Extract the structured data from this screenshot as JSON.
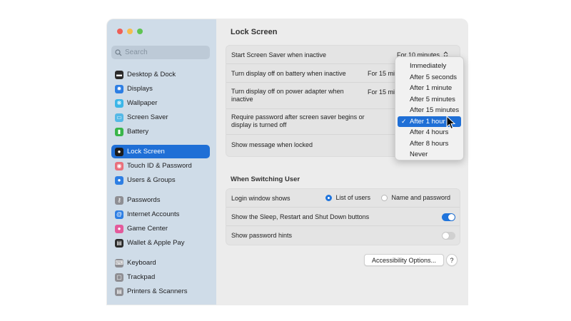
{
  "window": {
    "traffic_colors": [
      "#ee5f57",
      "#f5bd4f",
      "#5fc453"
    ]
  },
  "search": {
    "placeholder": "Search"
  },
  "sidebar": {
    "items": [
      {
        "label": "Desktop & Dock",
        "icon": "dock-icon",
        "color": "#2b2b2b"
      },
      {
        "label": "Displays",
        "icon": "display-icon",
        "color": "#2d7ee3"
      },
      {
        "label": "Wallpaper",
        "icon": "wallpaper-icon",
        "color": "#3bb6e8"
      },
      {
        "label": "Screen Saver",
        "icon": "screen-saver-icon",
        "color": "#54b8e6"
      },
      {
        "label": "Battery",
        "icon": "battery-icon",
        "color": "#39b54a"
      },
      {
        "label": "Lock Screen",
        "icon": "lock-icon",
        "color": "#1c1c1c",
        "selected": true
      },
      {
        "label": "Touch ID & Password",
        "icon": "fingerprint-icon",
        "color": "#e9707c"
      },
      {
        "label": "Users & Groups",
        "icon": "users-icon",
        "color": "#2d7ee3"
      },
      {
        "label": "Passwords",
        "icon": "key-icon",
        "color": "#8e8e93"
      },
      {
        "label": "Internet Accounts",
        "icon": "at-icon",
        "color": "#2d7ee3"
      },
      {
        "label": "Game Center",
        "icon": "game-center-icon",
        "color": "#e35a9b"
      },
      {
        "label": "Wallet & Apple Pay",
        "icon": "wallet-icon",
        "color": "#2b2b2b"
      },
      {
        "label": "Keyboard",
        "icon": "keyboard-icon",
        "color": "#8e8e93"
      },
      {
        "label": "Trackpad",
        "icon": "trackpad-icon",
        "color": "#8e8e93"
      },
      {
        "label": "Printers & Scanners",
        "icon": "printer-icon",
        "color": "#8e8e93"
      }
    ]
  },
  "main": {
    "title": "Lock Screen",
    "rows": [
      {
        "label": "Start Screen Saver when inactive",
        "value": "For 10 minutes"
      },
      {
        "label": "Turn display off on battery when inactive",
        "value": "For 15 mi"
      },
      {
        "label": "Turn display off on power adapter when inactive",
        "value": "For 15 mi"
      },
      {
        "label": "Require password after screen saver begins or display is turned off"
      },
      {
        "label": "Show message when locked"
      }
    ],
    "switching_header": "When Switching User",
    "login_label": "Login window shows",
    "login_option1": "List of users",
    "login_option2": "Name and password",
    "sleep_label": "Show the Sleep, Restart and Shut Down buttons",
    "sleep_on": true,
    "hints_label": "Show password hints",
    "hints_on": false,
    "accessibility_button": "Accessibility Options...",
    "help_button": "?"
  },
  "menu": {
    "items": [
      {
        "label": "Immediately"
      },
      {
        "label": "After 5 seconds"
      },
      {
        "label": "After 1 minute"
      },
      {
        "label": "After 5 minutes"
      },
      {
        "label": "After 15 minutes"
      },
      {
        "label": "After 1 hour",
        "selected": true
      },
      {
        "label": "After 4 hours"
      },
      {
        "label": "After 8 hours"
      },
      {
        "label": "Never"
      }
    ],
    "check": "✓"
  },
  "colors": {
    "accent": "#1f6fd6",
    "toggle_on": "#1f74dc",
    "toggle_off": "#d0d0d0"
  }
}
